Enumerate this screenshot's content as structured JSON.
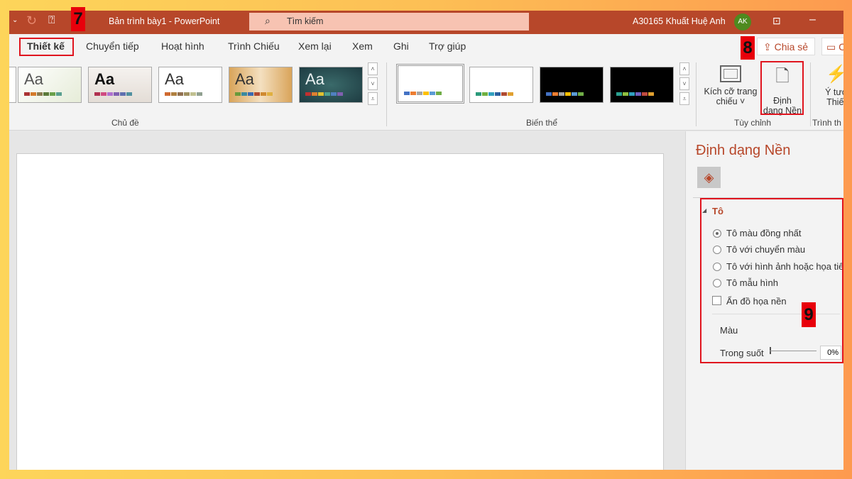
{
  "titlebar": {
    "doc_title": "Bản trình bày1  -  PowerPoint",
    "search_placeholder": "Tìm kiếm",
    "user_name": "A30165 Khuất Huệ Anh",
    "avatar_initials": "AK",
    "accent": "#b7472a"
  },
  "tabs": [
    {
      "label": "Thiết kế",
      "active": true
    },
    {
      "label": "Chuyển tiếp"
    },
    {
      "label": "Hoạt hình"
    },
    {
      "label": "Trình Chiếu"
    },
    {
      "label": "Xem lại"
    },
    {
      "label": "Xem"
    },
    {
      "label": "Ghi"
    },
    {
      "label": "Trợ giúp"
    }
  ],
  "share_label": "Chia sẻ",
  "comment_label": "C",
  "ribbon": {
    "themes_group": "Chủ đề",
    "themes": [
      "Aa",
      "Aa",
      "Aa",
      "Aa",
      "Aa"
    ],
    "variants_group": "Biến thể",
    "customize_group": "Tùy chỉnh",
    "slide_size_line1": "Kích cỡ trang",
    "slide_size_line2": "chiếu ˅",
    "format_bg_line1": "Định",
    "format_bg_line2": "dạng Nền",
    "designer_line1": "Ý tưở",
    "designer_line2": "Thiết",
    "designer_group": "Trình th"
  },
  "pane": {
    "title": "Định dạng Nền",
    "section": "Tô",
    "fill_options": [
      {
        "label": "Tô màu đồng nhất",
        "selected": true
      },
      {
        "label": "Tô với chuyển màu",
        "selected": false
      },
      {
        "label": "Tô với hình ảnh hoặc họa tiết",
        "selected": false
      },
      {
        "label": "Tô mẫu hình",
        "selected": false
      }
    ],
    "hide_graphics": "Ẩn đồ họa nền",
    "hide_graphics_checked": false,
    "color_label": "Màu",
    "transparency_label": "Trong suốt",
    "transparency_value": "0%"
  },
  "badges": [
    "7",
    "8",
    "9"
  ]
}
